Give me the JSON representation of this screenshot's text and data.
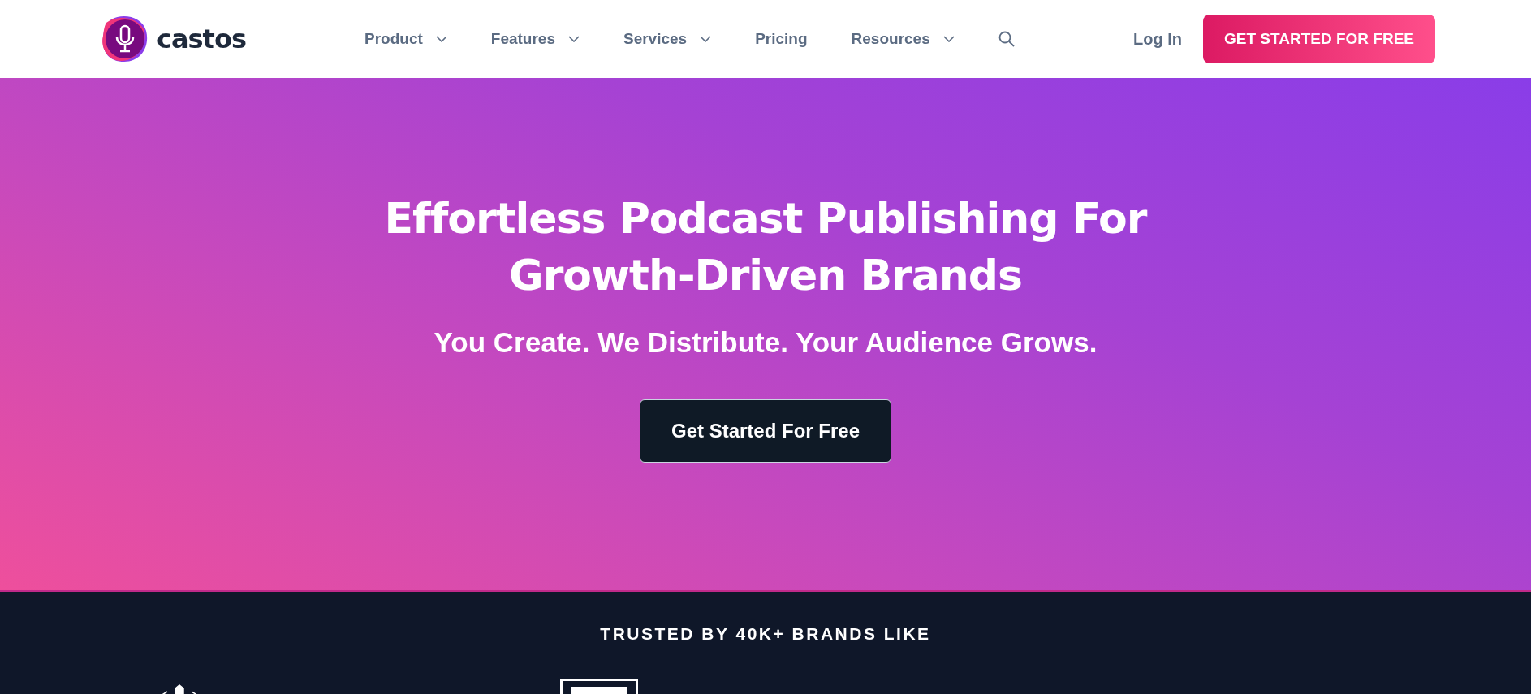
{
  "header": {
    "brand": "castos",
    "nav": [
      {
        "label": "Product",
        "dropdown": true
      },
      {
        "label": "Features",
        "dropdown": true
      },
      {
        "label": "Services",
        "dropdown": true
      },
      {
        "label": "Pricing",
        "dropdown": false
      },
      {
        "label": "Resources",
        "dropdown": true
      }
    ],
    "login": "Log In",
    "cta": "GET STARTED FOR FREE"
  },
  "hero": {
    "title_lines": [
      "Effortless Podcast Publishing For",
      "Growth-Driven Brands"
    ],
    "subtitle": "You Create. We Distribute. Your Audience Grows.",
    "button": "Get Started For Free"
  },
  "trusted": {
    "heading": "TRUSTED BY 40K+ BRANDS LIKE"
  }
}
